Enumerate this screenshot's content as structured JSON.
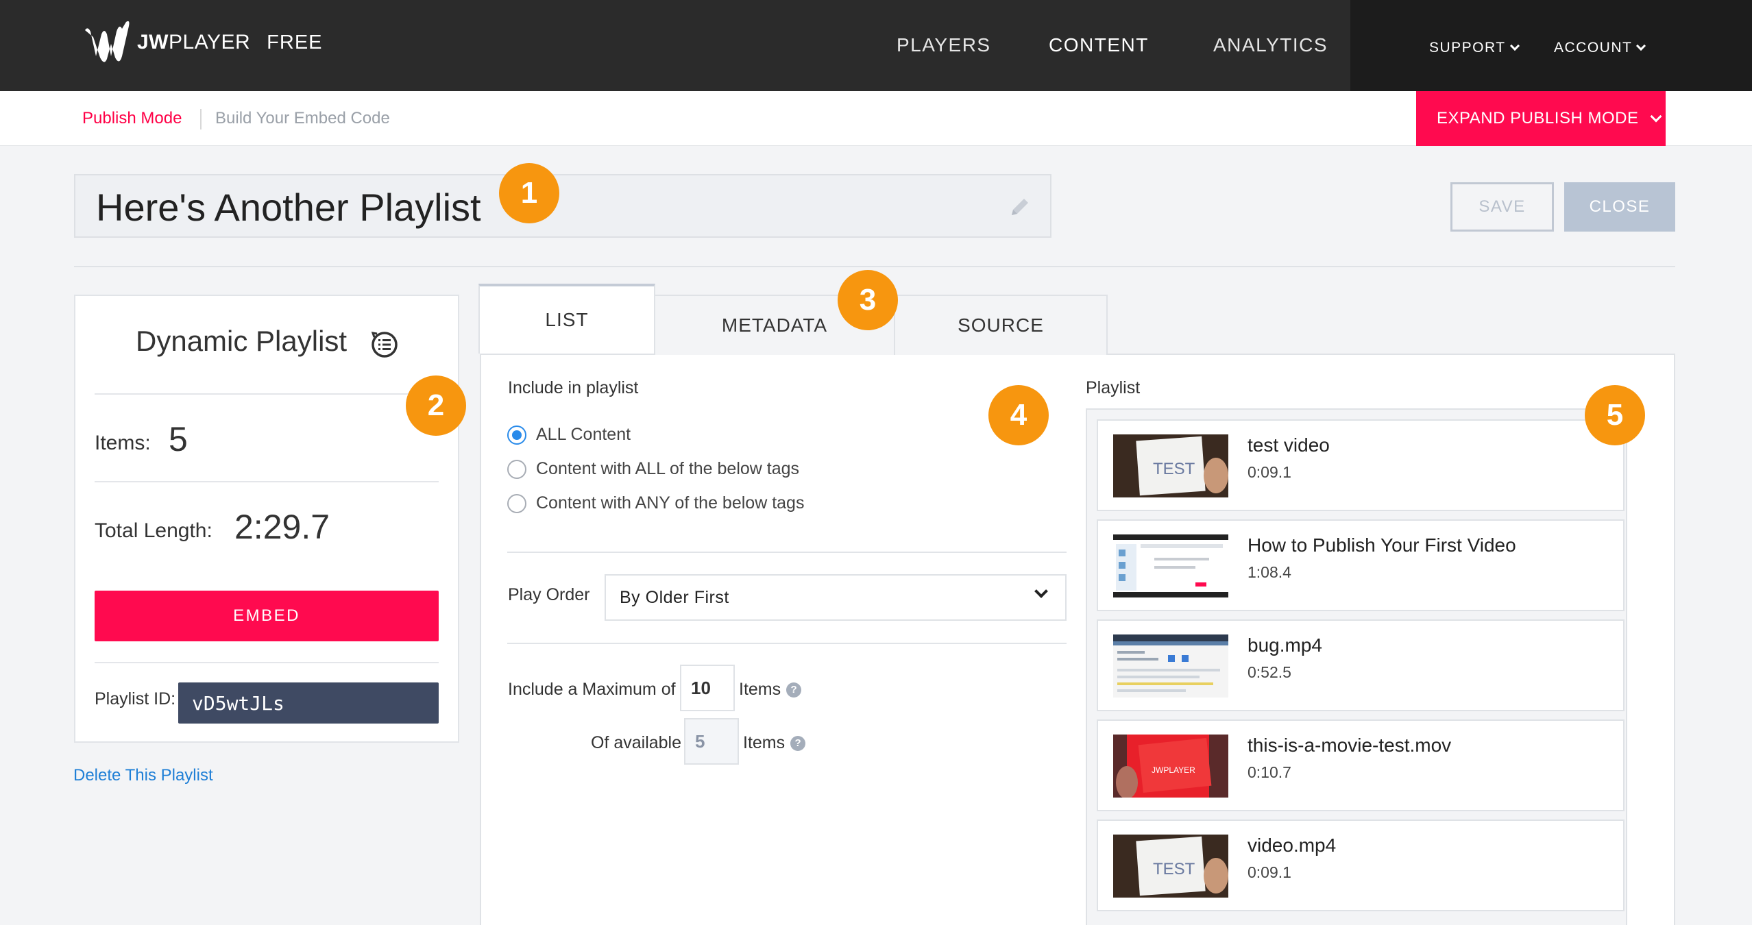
{
  "brand": {
    "name_bold": "JW",
    "name_light": "PLAYER",
    "tier": "FREE"
  },
  "nav": {
    "players": "PLAYERS",
    "content": "CONTENT",
    "analytics": "ANALYTICS",
    "support": "SUPPORT",
    "account": "ACCOUNT"
  },
  "subnav": {
    "mode": "Publish Mode",
    "embed_code": "Build Your Embed Code",
    "expand": "EXPAND PUBLISH MODE"
  },
  "playlist_title": "Here's Another Playlist",
  "actions": {
    "save": "SAVE",
    "close": "CLOSE"
  },
  "badges": [
    "1",
    "2",
    "3",
    "4",
    "5"
  ],
  "summary": {
    "type": "Dynamic Playlist",
    "items_label": "Items:",
    "items_value": "5",
    "length_label": "Total Length:",
    "length_value": "2:29.7",
    "embed": "EMBED",
    "id_label": "Playlist ID:",
    "id_value": "vD5wtJLs",
    "delete": "Delete This Playlist"
  },
  "tabs": {
    "list": "LIST",
    "metadata": "METADATA",
    "source": "SOURCE"
  },
  "include": {
    "label": "Include in playlist",
    "options": [
      "ALL Content",
      "Content with ALL of the below tags",
      "Content with ANY of the below tags"
    ],
    "selected": 0
  },
  "play_order": {
    "label": "Play Order",
    "value": "By Older First"
  },
  "maximum": {
    "prefix": "Include a Maximum of",
    "value": "10",
    "suffix": "Items"
  },
  "available": {
    "prefix": "Of available",
    "value": "5",
    "suffix": "Items"
  },
  "playlist": {
    "label": "Playlist",
    "items": [
      {
        "name": "test video",
        "duration": "0:09.1"
      },
      {
        "name": "How to Publish Your First Video",
        "duration": "1:08.4"
      },
      {
        "name": "bug.mp4",
        "duration": "0:52.5"
      },
      {
        "name": "this-is-a-movie-test.mov",
        "duration": "0:10.7"
      },
      {
        "name": "video.mp4",
        "duration": "0:09.1"
      }
    ]
  },
  "colors": {
    "accent": "#ff0a4f",
    "badge": "#f7960f",
    "link": "#1f7fd6",
    "nav_bg": "#2b2b2b"
  }
}
